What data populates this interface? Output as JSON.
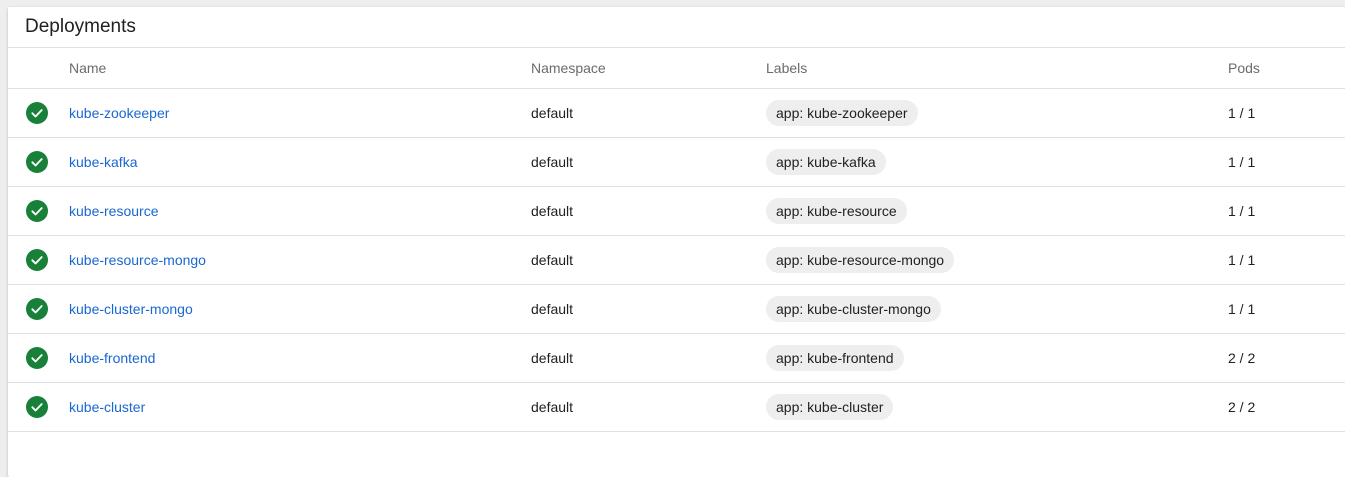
{
  "card": {
    "title": "Deployments"
  },
  "columns": {
    "name": "Name",
    "namespace": "Namespace",
    "labels": "Labels",
    "pods": "Pods"
  },
  "colors": {
    "success": "#188038",
    "link": "#1967d2",
    "chip_bg": "#eeeeee"
  },
  "rows": [
    {
      "status": "check-circle-icon",
      "name": "kube-zookeeper",
      "namespace": "default",
      "label": "app: kube-zookeeper",
      "pods": "1 / 1"
    },
    {
      "status": "check-circle-icon",
      "name": "kube-kafka",
      "namespace": "default",
      "label": "app: kube-kafka",
      "pods": "1 / 1"
    },
    {
      "status": "check-circle-icon",
      "name": "kube-resource",
      "namespace": "default",
      "label": "app: kube-resource",
      "pods": "1 / 1"
    },
    {
      "status": "check-circle-icon",
      "name": "kube-resource-mongo",
      "namespace": "default",
      "label": "app: kube-resource-mongo",
      "pods": "1 / 1"
    },
    {
      "status": "check-circle-icon",
      "name": "kube-cluster-mongo",
      "namespace": "default",
      "label": "app: kube-cluster-mongo",
      "pods": "1 / 1"
    },
    {
      "status": "check-circle-icon",
      "name": "kube-frontend",
      "namespace": "default",
      "label": "app: kube-frontend",
      "pods": "2 / 2"
    },
    {
      "status": "check-circle-icon",
      "name": "kube-cluster",
      "namespace": "default",
      "label": "app: kube-cluster",
      "pods": "2 / 2"
    }
  ]
}
